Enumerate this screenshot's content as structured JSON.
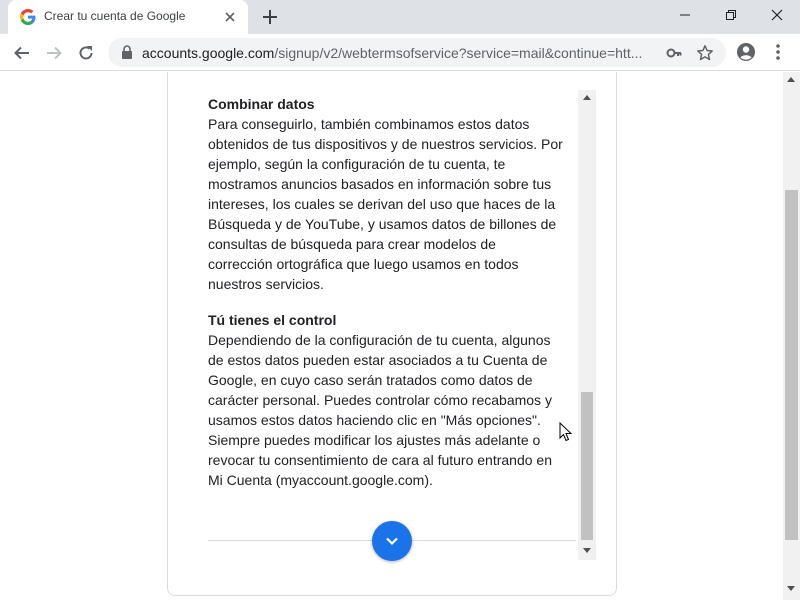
{
  "browser": {
    "tab": {
      "title": "Crear tu cuenta de Google",
      "favicon": "google-g-icon",
      "close_icon": "close-icon"
    },
    "new_tab_icon": "plus-icon",
    "window_controls": [
      "minimize-icon",
      "restore-icon",
      "close-icon"
    ],
    "nav": {
      "back_icon": "arrow-left-icon",
      "forward_icon": "arrow-right-icon",
      "reload_icon": "reload-icon"
    },
    "omnibox": {
      "host": "accounts.google.com",
      "path": "/signup/v2/webtermsofservice?service=mail&continue=htt...",
      "lock_icon": "lock-icon",
      "key_icon": "key-icon",
      "star_icon": "star-icon"
    },
    "profile_icon": "account-circle-icon",
    "menu_icon": "more-vert-icon"
  },
  "terms": {
    "sections": [
      {
        "heading": "Combinar datos",
        "body": "Para conseguirlo, también combinamos estos datos obtenidos de tus dispositivos y de nuestros servicios. Por ejemplo, según la configuración de tu cuenta, te mostramos anuncios basados en información sobre tus intereses, los cuales se derivan del uso que haces de la Búsqueda y de YouTube, y usamos datos de billones de consultas de búsqueda para crear modelos de corrección ortográfica que luego usamos en todos nuestros servicios."
      },
      {
        "heading": "Tú tienes el control",
        "body": "Dependiendo de la configuración de tu cuenta, algunos de estos datos pueden estar asociados a tu Cuenta de Google, en cuyo caso serán tratados como datos de carácter personal. Puedes controlar cómo recabamos y usamos estos datos haciendo clic en \"Más opciones\". Siempre puedes modificar los ajustes más adelante o revocar tu consentimiento de cara al futuro entrando en Mi Cuenta (myaccount.google.com)."
      }
    ],
    "scroll_down_icon": "chevron-down-icon"
  },
  "colors": {
    "accent": "#1a73e8",
    "text": "#202124",
    "tabbar": "#dee1e6"
  }
}
